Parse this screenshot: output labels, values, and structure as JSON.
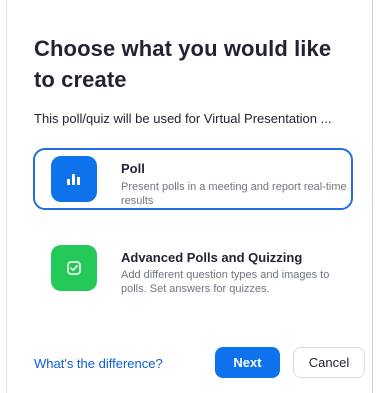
{
  "dialog": {
    "title": "Choose what you would like to create",
    "subtitle": "This poll/quiz will be used for Virtual Presentation ..."
  },
  "options": [
    {
      "title": "Poll",
      "description": "Present polls in a meeting and report real-time results",
      "icon": "bar-chart-icon",
      "icon_color": "#0E72ED",
      "selected": true
    },
    {
      "title": "Advanced Polls and Quizzing",
      "description": "Add different question types and images to polls. Set answers for quizzes.",
      "icon": "checkbox-icon",
      "icon_color": "#24C95A",
      "selected": false
    }
  ],
  "footer": {
    "help_link": "What's the difference?",
    "next_label": "Next",
    "cancel_label": "Cancel"
  },
  "colors": {
    "accent": "#0E72ED",
    "selected_border": "#1F6FE0",
    "link": "#0E5BD8"
  }
}
